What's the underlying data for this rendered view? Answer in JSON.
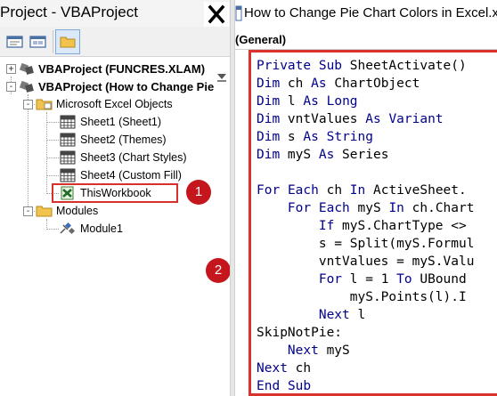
{
  "project_pane": {
    "title": "Project - VBAProject",
    "close_icon": "close-icon",
    "toolbar": [
      {
        "name": "view-code-icon"
      },
      {
        "name": "view-object-icon"
      },
      {
        "name": "toggle-folders-icon"
      }
    ],
    "tree": {
      "nodes": [
        {
          "label": "VBAProject (FUNCRES.XLAM)",
          "bold": true,
          "expander": "+"
        },
        {
          "label": "VBAProject (How to Change Pie",
          "bold": true,
          "expander": "-"
        },
        {
          "label": "Microsoft Excel Objects",
          "bold": false,
          "expander": "-"
        },
        {
          "label": "Sheet1 (Sheet1)"
        },
        {
          "label": "Sheet2 (Themes)"
        },
        {
          "label": "Sheet3 (Chart Styles)"
        },
        {
          "label": "Sheet4 (Custom Fill)"
        },
        {
          "label": "ThisWorkbook"
        },
        {
          "label": "Modules",
          "expander": "-"
        },
        {
          "label": "Module1"
        }
      ]
    },
    "badge_1": "1",
    "badge_2": "2"
  },
  "code_window": {
    "title": "How to Change Pie Chart Colors in Excel.xlsm",
    "object_combo": "(General)",
    "lines": [
      "Private Sub SheetActivate()",
      "Dim ch As ChartObject",
      "Dim l As Long",
      "Dim vntValues As Variant",
      "Dim s As String",
      "Dim myS As Series",
      "",
      "For Each ch In ActiveSheet.",
      "    For Each myS In ch.Chart",
      "        If myS.ChartType <>",
      "        s = Split(myS.Formul",
      "        vntValues = myS.Valu",
      "        For l = 1 To UBound",
      "            myS.Points(l).I",
      "        Next l",
      "SkipNotPie:",
      "    Next myS",
      "Next ch",
      "End Sub"
    ]
  },
  "colors": {
    "highlight_red": "#d8332c",
    "badge_red": "#c4161c",
    "keyword_blue": "#00008b"
  }
}
